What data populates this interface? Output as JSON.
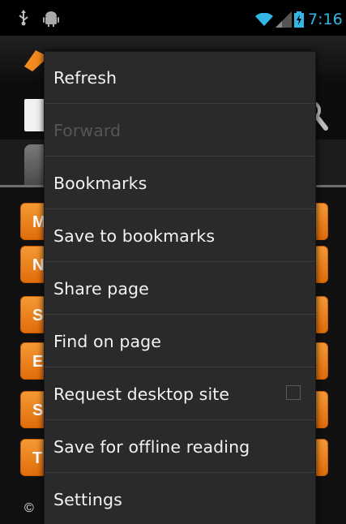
{
  "status_bar": {
    "time": "7:16",
    "icons": [
      "usb-icon",
      "android-debug-icon",
      "wifi-icon",
      "signal-icon",
      "battery-icon"
    ],
    "accent_color": "#33b5e5"
  },
  "background_page": {
    "buttons": [
      {
        "label": "M"
      },
      {
        "label": "N"
      },
      {
        "label": "S"
      },
      {
        "label": "E"
      },
      {
        "label": "S"
      },
      {
        "label": "T"
      }
    ],
    "footer_text": "©",
    "button_color": "#f28a1e"
  },
  "menu": {
    "items": [
      {
        "label": "Refresh",
        "enabled": true
      },
      {
        "label": "Forward",
        "enabled": false
      },
      {
        "label": "Bookmarks",
        "enabled": true
      },
      {
        "label": "Save to bookmarks",
        "enabled": true
      },
      {
        "label": "Share page",
        "enabled": true
      },
      {
        "label": "Find on page",
        "enabled": true
      },
      {
        "label": "Request desktop site",
        "enabled": true,
        "checkbox": false
      },
      {
        "label": "Save for offline reading",
        "enabled": true
      },
      {
        "label": "Settings",
        "enabled": true
      }
    ]
  }
}
